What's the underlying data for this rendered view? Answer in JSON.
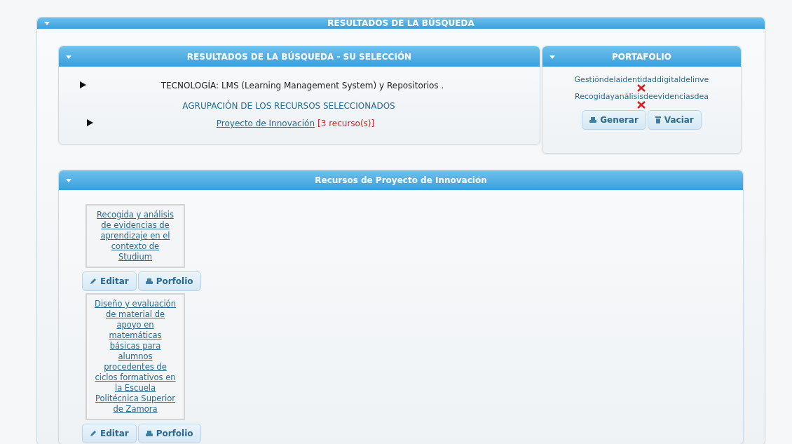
{
  "main_panel": {
    "title": "RESULTADOS DE LA BÚSQUEDA"
  },
  "selection_panel": {
    "title": "RESULTADOS DE LA BÚSQUEDA - SU SELECCIÓN",
    "technology": "TECNOLOGÍA: LMS (Learning Management System) y Repositorios .",
    "grouping_heading": "AGRUPACIÓN DE LOS RECURSOS SELECCIONADOS",
    "group_link": "Proyecto de Innovación",
    "group_count": "[3 recurso(s)]"
  },
  "portfolio": {
    "title": "PORTAFOLIO",
    "items": [
      {
        "name": "Gestióndelaidentidaddigitaldelinve"
      },
      {
        "name": "Recogidayanálisisdeevidenciasdea"
      }
    ],
    "buttons": [
      {
        "kind": "generate",
        "label": "Generar"
      },
      {
        "kind": "empty",
        "label": "Vaciar"
      }
    ]
  },
  "resources_panel": {
    "title": "Recursos de Proyecto de Innovación",
    "resources": [
      {
        "title": "Recogida y análisis de evidencias de aprendizaje en el contexto de Studium",
        "buttons": [
          {
            "kind": "edit",
            "label": "Editar"
          },
          {
            "kind": "portfolio",
            "label": "Porfolio"
          }
        ]
      },
      {
        "title": "Diseño y evaluación de material de apoyo en matemáticas básicas para alumnos procedentes de ciclos formativos en la Escuela Politécnica Superior de Zamora",
        "buttons": [
          {
            "kind": "edit",
            "label": "Editar"
          },
          {
            "kind": "portfolio",
            "label": "Porfolio"
          }
        ]
      }
    ]
  }
}
